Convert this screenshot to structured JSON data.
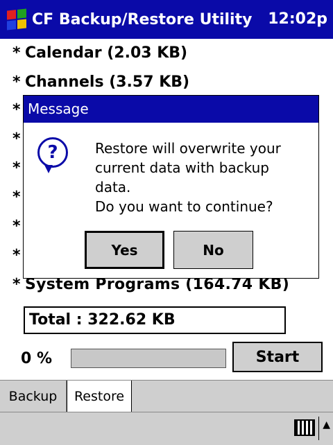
{
  "app": {
    "title": "CF Backup/Restore Utility",
    "clock": "12:02p"
  },
  "items": [
    {
      "bullet": "*",
      "text": "Calendar (2.03 KB)"
    },
    {
      "bullet": "*",
      "text": "Channels (3.57 KB)"
    },
    {
      "bullet": "*",
      "text": ""
    },
    {
      "bullet": "*",
      "text": ""
    },
    {
      "bullet": "*",
      "text": ""
    },
    {
      "bullet": "*",
      "text": ""
    },
    {
      "bullet": "*",
      "text": ""
    },
    {
      "bullet": "*",
      "text": ""
    },
    {
      "bullet": "*",
      "text": "System Programs (164.74 KB)"
    }
  ],
  "total": {
    "label": "Total :",
    "value": "322.62 KB"
  },
  "progress": {
    "label": "0 %",
    "percent": 0
  },
  "start_label": "Start",
  "tabs": [
    {
      "label": "Backup"
    },
    {
      "label": "Restore"
    }
  ],
  "dialog": {
    "title": "Message",
    "icon": "?",
    "lines": [
      "Restore will overwrite your",
      "current data with backup",
      "data.",
      "Do you want to continue?"
    ],
    "yes_label": "Yes",
    "no_label": "No"
  },
  "colors": {
    "titlebar": "#0a0aa8",
    "chrome": "#cfcfcf",
    "windows_logo": [
      "#e02020",
      "#20a020",
      "#2040e0",
      "#f0c000"
    ]
  }
}
